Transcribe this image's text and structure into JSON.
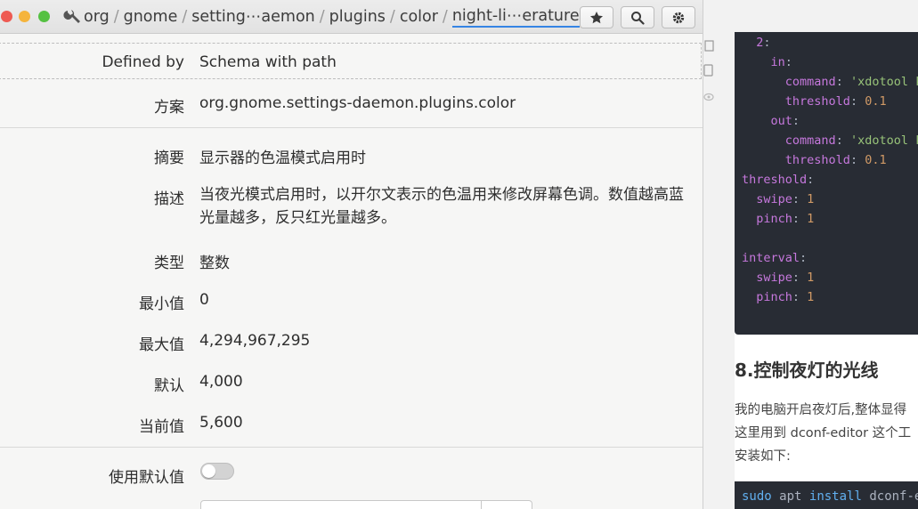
{
  "header": {
    "breadcrumbs": [
      "org",
      "gnome",
      "setting⋯aemon",
      "plugins",
      "color",
      "night-li⋯erature"
    ],
    "separator": "/"
  },
  "properties": {
    "defined_by": {
      "label": "Defined by",
      "value": "Schema with path"
    },
    "schema": {
      "label": "方案",
      "value": "org.gnome.settings-daemon.plugins.color"
    },
    "summary": {
      "label": "摘要",
      "value": "显示器的色温模式启用时"
    },
    "description": {
      "label": "描述",
      "value": "当夜光模式启用时，以开尔文表示的色温用来修改屏幕色调。数值越高蓝光量越多，反只红光量越多。"
    },
    "type": {
      "label": "类型",
      "value": "整数"
    },
    "minimum": {
      "label": "最小值",
      "value": "0"
    },
    "maximum": {
      "label": "最大值",
      "value": "4,294,967,295"
    },
    "default": {
      "label": "默认",
      "value": "4,000"
    },
    "current": {
      "label": "当前值",
      "value": "5,600"
    },
    "use_default": {
      "label": "使用默认值",
      "enabled": false
    }
  },
  "web_page": {
    "code_lines": [
      {
        "indent": "  ",
        "key": "2",
        "rest": ""
      },
      {
        "indent": "    ",
        "key": "in",
        "rest": ""
      },
      {
        "indent": "      ",
        "key": "command",
        "rest": "'xdotool k"
      },
      {
        "indent": "      ",
        "key": "threshold",
        "rest": "0.1"
      },
      {
        "indent": "    ",
        "key": "out",
        "rest": ""
      },
      {
        "indent": "      ",
        "key": "command",
        "rest": "'xdotool k"
      },
      {
        "indent": "      ",
        "key": "threshold",
        "rest": "0.1"
      },
      {
        "indent": "",
        "key": "threshold",
        "rest": ""
      },
      {
        "indent": "  ",
        "key": "swipe",
        "rest": "1"
      },
      {
        "indent": "  ",
        "key": "pinch",
        "rest": "1"
      },
      {
        "indent": "",
        "key": "",
        "rest": ""
      },
      {
        "indent": "",
        "key": "interval",
        "rest": ""
      },
      {
        "indent": "  ",
        "key": "swipe",
        "rest": "1"
      },
      {
        "indent": "  ",
        "key": "pinch",
        "rest": "1"
      }
    ],
    "heading": "8.控制夜灯的光线",
    "paragraph_lines": [
      "我的电脑开启夜灯后,整体显得",
      "这里用到 dconf-editor 这个工",
      "安装如下:"
    ],
    "install_cmd": {
      "sudo": "sudo",
      "apt": "apt",
      "install": "install",
      "pkg": "dconf-ed"
    }
  }
}
